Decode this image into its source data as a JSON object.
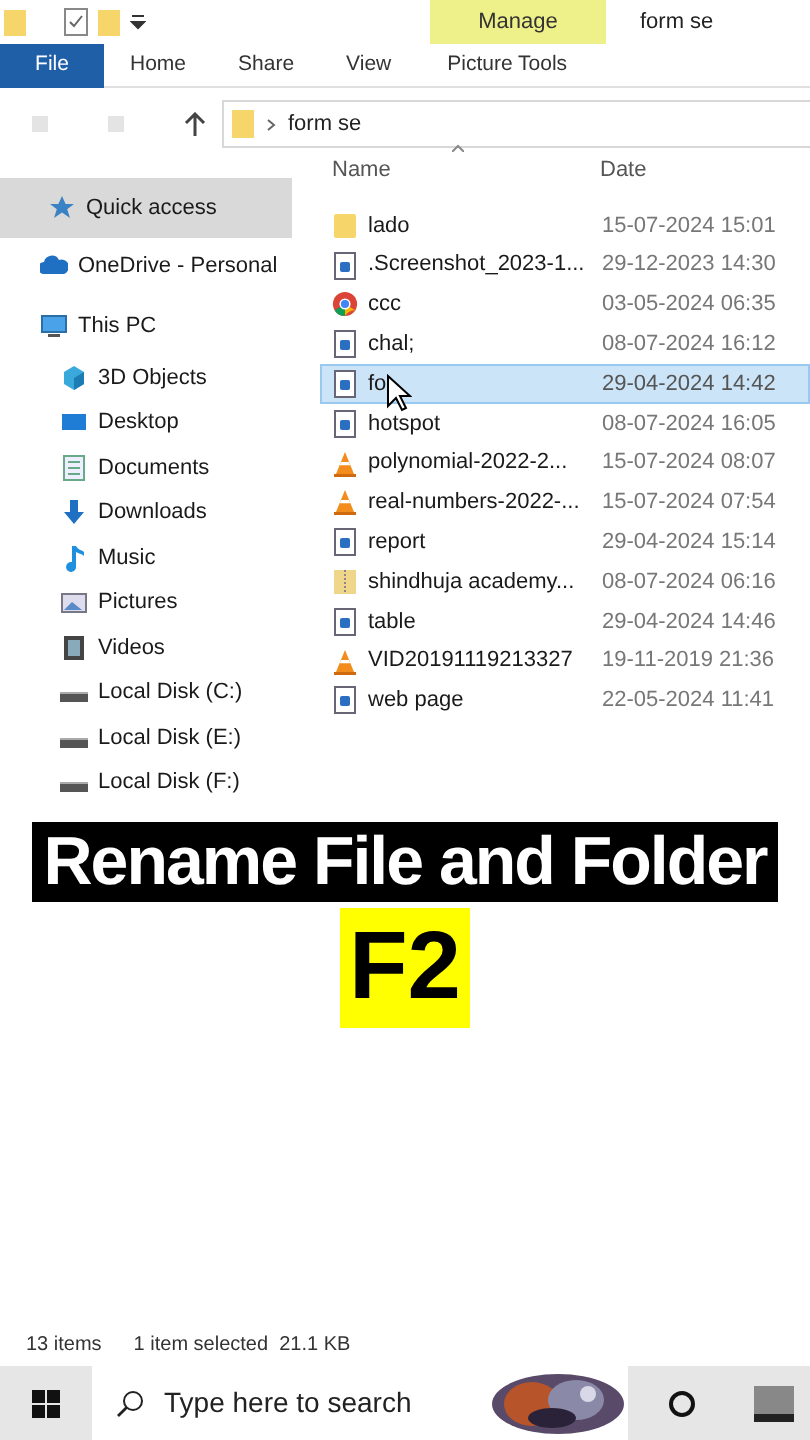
{
  "ribbon": {
    "context_tab": "Manage",
    "title": "form se",
    "tabs": [
      {
        "label": "File",
        "selected": true
      },
      {
        "label": "Home",
        "selected": false
      },
      {
        "label": "Share",
        "selected": false
      },
      {
        "label": "View",
        "selected": false
      },
      {
        "label": "Picture Tools",
        "selected": false
      }
    ]
  },
  "address": {
    "path": "form se"
  },
  "sidebar": {
    "items": [
      {
        "label": "Quick access",
        "kind": "star",
        "selected": true
      },
      {
        "label": "OneDrive - Personal",
        "kind": "cloud",
        "selected": false
      },
      {
        "label": "This PC",
        "kind": "pc",
        "selected": false,
        "children": [
          {
            "label": "3D Objects",
            "kind": "cube",
            "selected": false
          },
          {
            "label": "Desktop",
            "kind": "desktop",
            "selected": false
          },
          {
            "label": "Documents",
            "kind": "docs",
            "selected": false
          },
          {
            "label": "Downloads",
            "kind": "download",
            "selected": false
          },
          {
            "label": "Music",
            "kind": "music",
            "selected": false
          },
          {
            "label": "Pictures",
            "kind": "pictures",
            "selected": false
          },
          {
            "label": "Videos",
            "kind": "videos",
            "selected": false
          },
          {
            "label": "Local Disk (C:)",
            "kind": "disk",
            "selected": false
          },
          {
            "label": "Local Disk (E:)",
            "kind": "disk",
            "selected": false
          },
          {
            "label": "Local Disk (F:)",
            "kind": "disk",
            "selected": false
          }
        ]
      }
    ]
  },
  "table": {
    "columns": [
      "Name",
      "Date"
    ],
    "rows": [
      {
        "name": "lado",
        "date": "15-07-2024 15:01",
        "kind": "folder",
        "selected": false
      },
      {
        "name": ".Screenshot_2023-1...",
        "date": "29-12-2023 14:30",
        "kind": "doc",
        "selected": false
      },
      {
        "name": "ccc",
        "date": "03-05-2024 06:35",
        "kind": "chrome",
        "selected": false
      },
      {
        "name": "chal;",
        "date": "08-07-2024 16:12",
        "kind": "doc",
        "selected": false
      },
      {
        "name": "fo",
        "date": "29-04-2024 14:42",
        "kind": "doc",
        "selected": true
      },
      {
        "name": "hotspot",
        "date": "08-07-2024 16:05",
        "kind": "doc",
        "selected": false
      },
      {
        "name": "polynomial-2022-2...",
        "date": "15-07-2024 08:07",
        "kind": "cone",
        "selected": false
      },
      {
        "name": "real-numbers-2022-...",
        "date": "15-07-2024 07:54",
        "kind": "cone",
        "selected": false
      },
      {
        "name": "report",
        "date": "29-04-2024 15:14",
        "kind": "doc",
        "selected": false
      },
      {
        "name": "shindhuja academy...",
        "date": "08-07-2024 06:16",
        "kind": "zip",
        "selected": false
      },
      {
        "name": "table",
        "date": "29-04-2024 14:46",
        "kind": "doc",
        "selected": false
      },
      {
        "name": "VID20191119213327",
        "date": "19-11-2019 21:36",
        "kind": "cone",
        "selected": false
      },
      {
        "name": "web page",
        "date": "22-05-2024 11:41",
        "kind": "doc",
        "selected": false
      }
    ]
  },
  "caption": {
    "title": "Rename File and Folder",
    "key": "F2"
  },
  "status_bar": {
    "count": "13 items",
    "selection": "1 item selected  21.1 KB"
  },
  "taskbar": {
    "search": {
      "placeholder": "Type here to search"
    }
  }
}
